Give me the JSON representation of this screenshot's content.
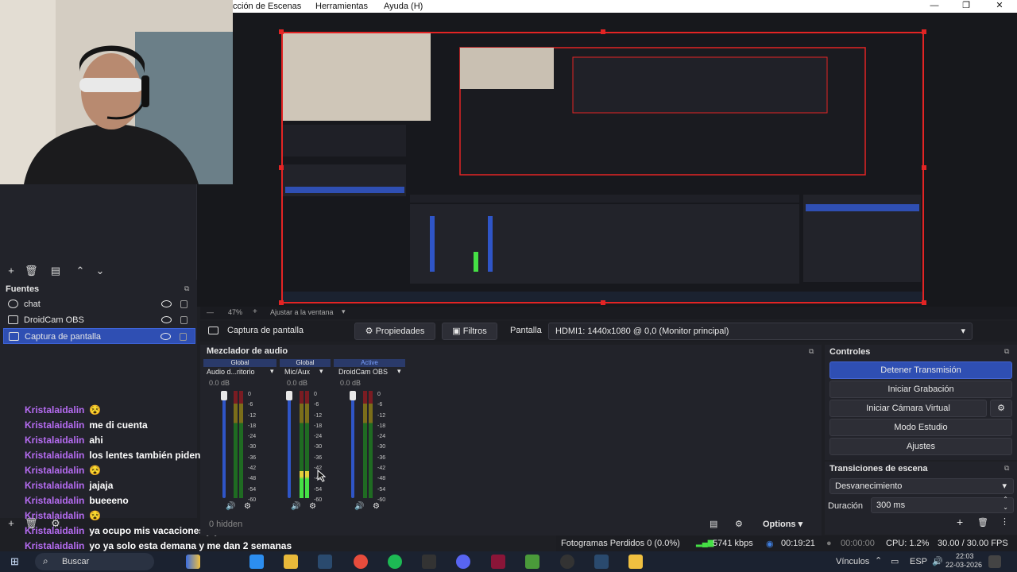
{
  "menubar": {
    "items": [
      "cción de Escenas",
      "Herramientas",
      "Ayuda (H)"
    ],
    "minimize": "—",
    "maximize": "❐",
    "close": "✕"
  },
  "preview": {
    "zoom": "47%",
    "fit_label": "Ajustar a la ventana"
  },
  "sources": {
    "title": "Fuentes",
    "items": [
      {
        "label": "chat"
      },
      {
        "label": "DroidCam OBS"
      },
      {
        "label": "Captura de pantalla"
      }
    ]
  },
  "chat": [
    {
      "user": "Kristalaidalin",
      "msg": "😵"
    },
    {
      "user": "Kristalaidalin",
      "msg": "me di cuenta"
    },
    {
      "user": "Kristalaidalin",
      "msg": "ahi"
    },
    {
      "user": "Kristalaidalin",
      "msg": "los lentes también piden jubilación jaja"
    },
    {
      "user": "Kristalaidalin",
      "msg": "😵"
    },
    {
      "user": "Kristalaidalin",
      "msg": "jajaja"
    },
    {
      "user": "Kristalaidalin",
      "msg": "bueeeno"
    },
    {
      "user": "Kristalaidalin",
      "msg": "😵"
    },
    {
      "user": "Kristalaidalin",
      "msg": "ya ocupo mis vacaciones jaja"
    },
    {
      "user": "Kristalaidalin",
      "msg": "yo ya solo esta demana y me dan 2 semanas"
    }
  ],
  "propbar": {
    "source_name": "Captura de pantalla",
    "properties": "Propiedades",
    "filters": "Filtros",
    "screen_label": "Pantalla",
    "screen_value": "HDMI1: 1440x1080 @ 0,0 (Monitor principal)"
  },
  "mixer": {
    "title": "Mezclador de audio",
    "hidden": "0 hidden",
    "options": "Options",
    "channels": [
      {
        "header": "Global",
        "name": "Audio d...ritorio",
        "db": "0.0 dB",
        "level": 0
      },
      {
        "header": "Global",
        "name": "Mic/Aux",
        "db": "0.0 dB",
        "level": 0.25
      },
      {
        "header": "Active",
        "name": "DroidCam OBS",
        "db": "0.0 dB",
        "level": 0
      }
    ],
    "scale": [
      "0",
      "-6",
      "-12",
      "-18",
      "-24",
      "-30",
      "-36",
      "-42",
      "-48",
      "-54",
      "-60"
    ]
  },
  "controls": {
    "title": "Controles",
    "stop_stream": "Detener Transmisión",
    "start_recording": "Iniciar Grabación",
    "virtual_cam": "Iniciar Cámara Virtual",
    "studio_mode": "Modo Estudio",
    "settings": "Ajustes"
  },
  "transitions": {
    "title": "Transiciones de escena",
    "selected": "Desvanecimiento",
    "duration_label": "Duración",
    "duration_value": "300 ms"
  },
  "status": {
    "dropped": "Fotogramas Perdidos 0 (0.0%)",
    "bitrate": "5741 kbps",
    "stream_time": "00:19:21",
    "rec_time": "00:00:00",
    "cpu": "CPU: 1.2%",
    "fps": "30.00 / 30.00 FPS"
  },
  "taskbar": {
    "search": "Buscar",
    "links": "Vínculos",
    "lang": "ESP",
    "time": "22:03",
    "date": "22-03-2026"
  }
}
